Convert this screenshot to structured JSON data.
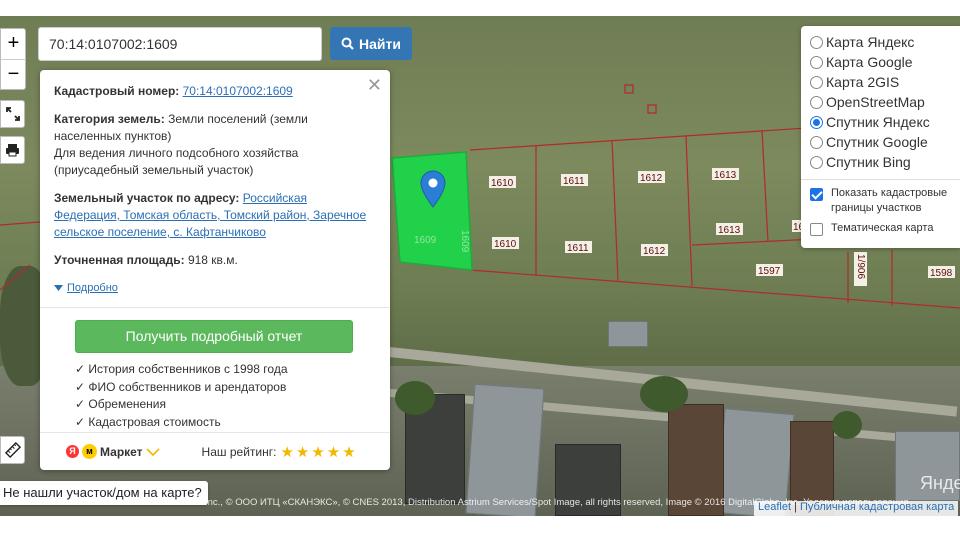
{
  "search": {
    "value": "70:14:0107002:1609",
    "button_label": "Найти"
  },
  "zoom": {
    "in": "+",
    "out": "−"
  },
  "popup": {
    "cadastral_label": "Кадастровый номер:",
    "cadastral_value": "70:14:0107002:1609",
    "category_label": "Категория земель:",
    "category_value": "Земли поселений (земли населенных пунктов)",
    "usage_text": "Для ведения личного подсобного хозяйства (приусадебный земельный участок)",
    "address_label": "Земельный участок по адресу:",
    "address_value": "Российская Федерация, Томская область, Томский район, Заречное сельское поселение, с. Кафтанчиково",
    "area_label": "Уточненная площадь:",
    "area_value": "918 кв.м.",
    "more_label": "Подробно",
    "report_button": "Получить подробный отчет",
    "features": [
      "История собственников с 1998 года",
      "ФИО собственников и арендаторов",
      "Обременения",
      "Кадастровая стоимость"
    ],
    "market_label": "Маркет",
    "rating_label": "Наш рейтинг:",
    "rating_value": 5,
    "rating_max": 5
  },
  "layers": {
    "options": [
      {
        "label": "Карта Яндекс",
        "selected": false
      },
      {
        "label": "Карта Google",
        "selected": false
      },
      {
        "label": "Карта 2GIS",
        "selected": false
      },
      {
        "label": "OpenStreetMap",
        "selected": false
      },
      {
        "label": "Спутник Яндекс",
        "selected": true
      },
      {
        "label": "Спутник Google",
        "selected": false
      },
      {
        "label": "Спутник Bing",
        "selected": false
      }
    ],
    "overlay_cadastral": {
      "label": "Показать кадастровые границы участков",
      "checked": true
    },
    "overlay_thematic": {
      "label": "Тематическая карта",
      "checked": false
    }
  },
  "parcels": [
    "1610",
    "1611",
    "1612",
    "1613",
    "1610",
    "1611",
    "1612",
    "1613",
    "1597",
    "1598",
    "1609",
    "1609"
  ],
  "parcel_partial_labels": [
    "16",
    "1/906"
  ],
  "not_found": "Не нашли участок/дом на карте?",
  "attribution": "Inc., © ООО ИТЦ «СКАНЭКС», © CNES 2013, Distribution Astrium Services/Spot Image, all rights reserved, Image © 2016 DigitalGlobe, Inc. Условия использования",
  "leaflet": {
    "leaflet_link": "Leaflet",
    "separator": "|",
    "pkk_link": "Публичная кадастровая карта"
  },
  "yandex_mark": "Янде",
  "colors": {
    "accent_blue": "#3475b4",
    "report_green": "#5cb85c",
    "selected_parcel": "#22d14a",
    "parcel_border": "#b22a2a"
  }
}
